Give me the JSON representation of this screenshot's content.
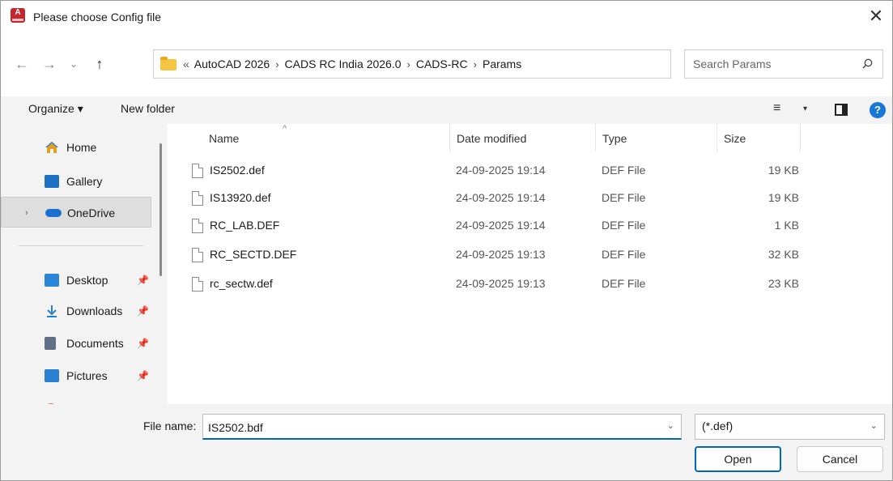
{
  "window": {
    "title": "Please choose Config file",
    "close_glyph": "✕"
  },
  "nav": {
    "back": "←",
    "forward": "→",
    "recent": "⌄",
    "up": "↑",
    "breadcrumb_lead": "«",
    "breadcrumbs": [
      "AutoCAD 2026",
      "CADS RC India 2026.0",
      "CADS-RC",
      "Params"
    ],
    "separator": "›",
    "address_dropdown": "⌄",
    "refresh": "↻",
    "search_placeholder": "Search Params"
  },
  "toolbar": {
    "organize_label": "Organize ▾",
    "new_folder_label": "New folder",
    "view_glyph": "≡",
    "view_dropdown_glyph": "▾",
    "help_glyph": "?"
  },
  "sidebar": {
    "items": [
      {
        "label": "Home",
        "icon": "home-icon"
      },
      {
        "label": "Gallery",
        "icon": "gallery-icon"
      },
      {
        "label": "OneDrive",
        "icon": "onedrive-icon",
        "expand": "›"
      },
      {
        "label": "Desktop",
        "icon": "desktop-icon",
        "pin": "📌"
      },
      {
        "label": "Downloads",
        "icon": "download-icon",
        "pin": "📌"
      },
      {
        "label": "Documents",
        "icon": "documents-icon",
        "pin": "📌"
      },
      {
        "label": "Pictures",
        "icon": "pictures-icon",
        "pin": "📌"
      }
    ]
  },
  "filelist": {
    "sort_glyph": "^",
    "columns": {
      "name": "Name",
      "date": "Date modified",
      "type": "Type",
      "size": "Size"
    },
    "rows": [
      {
        "name": "IS2502.def",
        "date": "24-09-2025 19:14",
        "type": "DEF File",
        "size": "19 KB"
      },
      {
        "name": "IS13920.def",
        "date": "24-09-2025 19:14",
        "type": "DEF File",
        "size": "19 KB"
      },
      {
        "name": "RC_LAB.DEF",
        "date": "24-09-2025 19:14",
        "type": "DEF File",
        "size": "1 KB"
      },
      {
        "name": "RC_SECTD.DEF",
        "date": "24-09-2025 19:13",
        "type": "DEF File",
        "size": "32 KB"
      },
      {
        "name": "rc_sectw.def",
        "date": "24-09-2025 19:13",
        "type": "DEF File",
        "size": "23 KB"
      }
    ]
  },
  "footer": {
    "file_name_label": "File name:",
    "file_name_value": "IS2502.bdf",
    "file_name_dropdown": "⌄",
    "file_type_value": "(*.def)",
    "file_type_dropdown": "⌄",
    "open_label": "Open",
    "cancel_label": "Cancel"
  },
  "colors": {
    "accent": "#0067c0",
    "app_icon": "#c4262e",
    "pane_bg": "#f3f3f3",
    "help_icon": "#1877d6"
  }
}
